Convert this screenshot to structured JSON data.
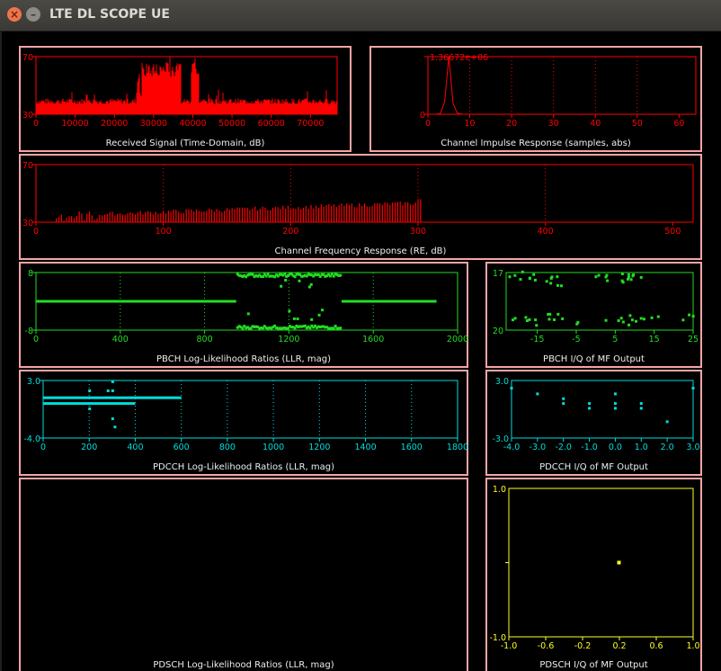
{
  "window": {
    "title": "LTE DL SCOPE UE",
    "close_glyph": "×",
    "minimize_glyph": "–"
  },
  "plots": {
    "rx": {
      "label": "Received Signal (Time-Domain, dB)",
      "color": "#ff0000",
      "ylim": [
        30,
        70
      ],
      "xlim": [
        0,
        76800
      ],
      "xticks": [
        "0",
        "10000",
        "20000",
        "30000",
        "40000",
        "50000",
        "60000",
        "70000"
      ],
      "yticks": [
        "70",
        "30"
      ],
      "baseline": 37,
      "burst_level": 66
    },
    "cir": {
      "label": "Channel Impulse Response (samples, abs)",
      "color": "#ff0000",
      "ylim": [
        0,
        1366720
      ],
      "xlim": [
        0,
        64
      ],
      "xticks": [
        "0",
        "10",
        "20",
        "30",
        "40",
        "50",
        "60"
      ],
      "yticks": [
        "1.36672e+06",
        "0"
      ],
      "peak_x": 5
    },
    "cfr": {
      "label": "Channel Frequency Response (RE, dB)",
      "color": "#ff0000",
      "ylim": [
        30,
        70
      ],
      "xlim": [
        0,
        516
      ],
      "xticks": [
        "0",
        "100",
        "200",
        "300",
        "400",
        "500"
      ],
      "yticks": [
        "70",
        "30"
      ],
      "active_from": 16,
      "active_to": 303
    },
    "pbch_llr": {
      "label": "PBCH Log-Likelihood Ratios (LLR, mag)",
      "color": "#22dd22",
      "ylim": [
        -8,
        8
      ],
      "xlim": [
        0,
        2000
      ],
      "xticks": [
        "0",
        "400",
        "800",
        "1200",
        "1600",
        "2000"
      ],
      "yticks": [
        "8",
        "-8"
      ]
    },
    "pbch_iq": {
      "label": "PBCH I/Q of MF Output",
      "color": "#22dd22",
      "ylim": [
        20,
        17
      ],
      "xlim": [
        -23,
        25
      ],
      "xticks": [
        "-15",
        "-5",
        "5",
        "15",
        "25"
      ],
      "yticks": [
        "17",
        "20"
      ]
    },
    "pdcch_llr": {
      "label": "PDCCH Log-Likelihood Ratios (LLR, mag)",
      "color": "#00dddd",
      "ylim": [
        -4,
        3
      ],
      "xlim": [
        0,
        1800
      ],
      "xticks": [
        "0",
        "200",
        "400",
        "600",
        "800",
        "1000",
        "1200",
        "1400",
        "1600",
        "1800"
      ],
      "yticks": [
        "3.0",
        "-4.0"
      ]
    },
    "pdcch_iq": {
      "label": "PDCCH I/Q of MF Output",
      "color": "#00dddd",
      "ylim": [
        -3,
        3
      ],
      "xlim": [
        -4,
        3
      ],
      "xticks": [
        "-4.0",
        "-3.0",
        "-2.0",
        "-1.0",
        "0.0",
        "1.0",
        "2.0",
        "3.0"
      ],
      "yticks": [
        "3.0",
        "-3.0"
      ]
    },
    "pdsch_llr": {
      "label": "PDSCH Log-Likelihood Ratios (LLR, mag)"
    },
    "pdsch_iq": {
      "label": "PDSCH I/Q of MF Output",
      "color": "#ffff22",
      "ylim": [
        -1,
        1
      ],
      "xlim": [
        -1,
        1
      ],
      "xticks": [
        "-1.0",
        "-0.6",
        "-0.2",
        "0.2",
        "0.6",
        "1.0"
      ],
      "yticks": [
        "1.0",
        "-1.0"
      ],
      "point": [
        0.0,
        0.0
      ]
    }
  },
  "chart_data": [
    {
      "type": "bar",
      "title": "Received Signal (Time-Domain, dB)",
      "xlim": [
        0,
        76800
      ],
      "ylim": [
        30,
        70
      ],
      "series": [
        {
          "x": [
            0,
            2000,
            4000,
            6000,
            8000,
            10000,
            12000,
            14000,
            16000,
            18000,
            20000,
            22000,
            24000,
            26000,
            28000,
            30000,
            32000,
            34000,
            36000,
            38000,
            40000,
            42000,
            44000,
            46000,
            48000,
            50000,
            52000,
            54000,
            56000,
            58000,
            60000,
            62000,
            64000,
            66000,
            68000,
            70000,
            72000,
            74000,
            76000
          ],
          "y": [
            37,
            38,
            37,
            38,
            37,
            37,
            38,
            37,
            38,
            37,
            38,
            37,
            38,
            37,
            66,
            66,
            66,
            66,
            37,
            37,
            66,
            38,
            37,
            37,
            38,
            37,
            38,
            37,
            38,
            37,
            38,
            37,
            38,
            37,
            38,
            37,
            38,
            37,
            37
          ]
        }
      ]
    },
    {
      "type": "line",
      "title": "Channel Impulse Response (samples, abs)",
      "xlim": [
        0,
        64
      ],
      "ylim": [
        0,
        1366720
      ],
      "series": [
        {
          "x": [
            0,
            1,
            2,
            3,
            4,
            5,
            6,
            7,
            8,
            9,
            10,
            15,
            20,
            30,
            40,
            50,
            60,
            64
          ],
          "y": [
            0,
            0,
            0,
            20000,
            300000,
            1366720,
            260000,
            30000,
            0,
            0,
            0,
            0,
            0,
            0,
            0,
            0,
            0,
            0
          ]
        }
      ]
    },
    {
      "type": "bar",
      "title": "Channel Frequency Response (RE, dB)",
      "xlim": [
        0,
        516
      ],
      "ylim": [
        30,
        70
      ],
      "series": [
        {
          "x": [
            16,
            25,
            40,
            50,
            75,
            100,
            150,
            200,
            250,
            300,
            303
          ],
          "y": [
            32,
            37,
            33,
            36,
            38,
            40,
            40,
            41,
            42,
            43,
            47
          ]
        }
      ]
    },
    {
      "type": "scatter",
      "title": "PBCH Log-Likelihood Ratios (LLR, mag)",
      "xlim": [
        0,
        2000
      ],
      "ylim": [
        -8,
        8
      ],
      "series": [
        {
          "x": [
            0,
            200,
            400,
            600,
            800,
            940,
            1000,
            1100,
            1200,
            1300,
            1400,
            1450,
            1500,
            1700,
            1900
          ],
          "y": [
            0,
            0,
            0,
            0,
            0,
            0,
            7.3,
            7.3,
            7.3,
            7.3,
            7.3,
            0,
            0,
            0,
            0
          ]
        },
        {
          "x": [
            1000,
            1100,
            1200,
            1300,
            1400
          ],
          "y": [
            -7.3,
            -7.3,
            -7.3,
            -7.3,
            -7.3
          ]
        }
      ]
    },
    {
      "type": "scatter",
      "title": "PBCH I/Q of MF Output",
      "xlim": [
        -23,
        25
      ],
      "ylim": [
        20,
        17
      ],
      "series": [
        {
          "x": [
            -20,
            -17,
            -15,
            -12,
            -10,
            2,
            5,
            8,
            10,
            12,
            -20,
            -16,
            -13,
            -10,
            -7,
            5,
            8,
            11,
            14,
            24
          ],
          "y": [
            17.1,
            17.3,
            17.4,
            17.2,
            17.5,
            17.3,
            17.1,
            17.4,
            17.2,
            17.3,
            19.5,
            19.4,
            19.6,
            19.3,
            19.5,
            19.5,
            19.4,
            19.6,
            19.5,
            19.3
          ]
        }
      ]
    },
    {
      "type": "scatter",
      "title": "PDCCH Log-Likelihood Ratios (LLR, mag)",
      "xlim": [
        0,
        1800
      ],
      "ylim": [
        -4,
        3
      ],
      "series": [
        {
          "x": [
            0,
            100,
            200,
            300,
            400,
            500,
            600
          ],
          "y": [
            0.9,
            0.9,
            0.9,
            0.9,
            0.9,
            0.9,
            0.9
          ]
        },
        {
          "x": [
            0,
            100,
            200,
            300,
            400
          ],
          "y": [
            0.2,
            0.2,
            0.2,
            0.2,
            0.2
          ]
        }
      ]
    },
    {
      "type": "scatter",
      "title": "PDCCH I/Q of MF Output",
      "xlim": [
        -4,
        3
      ],
      "ylim": [
        -3,
        3
      ],
      "series": [
        {
          "x": [
            -4,
            -3,
            -2,
            -2,
            -1,
            -1,
            0,
            0,
            0,
            1,
            1,
            2,
            3
          ],
          "y": [
            2.2,
            1.6,
            1.1,
            0.6,
            0.6,
            0.1,
            1.6,
            0.6,
            0.1,
            0.6,
            0.1,
            -1.3,
            2.2
          ]
        }
      ]
    },
    {
      "type": "scatter",
      "title": "PDSCH I/Q of MF Output",
      "xlim": [
        -1,
        1
      ],
      "ylim": [
        -1,
        1
      ],
      "series": [
        {
          "x": [
            0.0
          ],
          "y": [
            0.0
          ]
        }
      ]
    }
  ]
}
